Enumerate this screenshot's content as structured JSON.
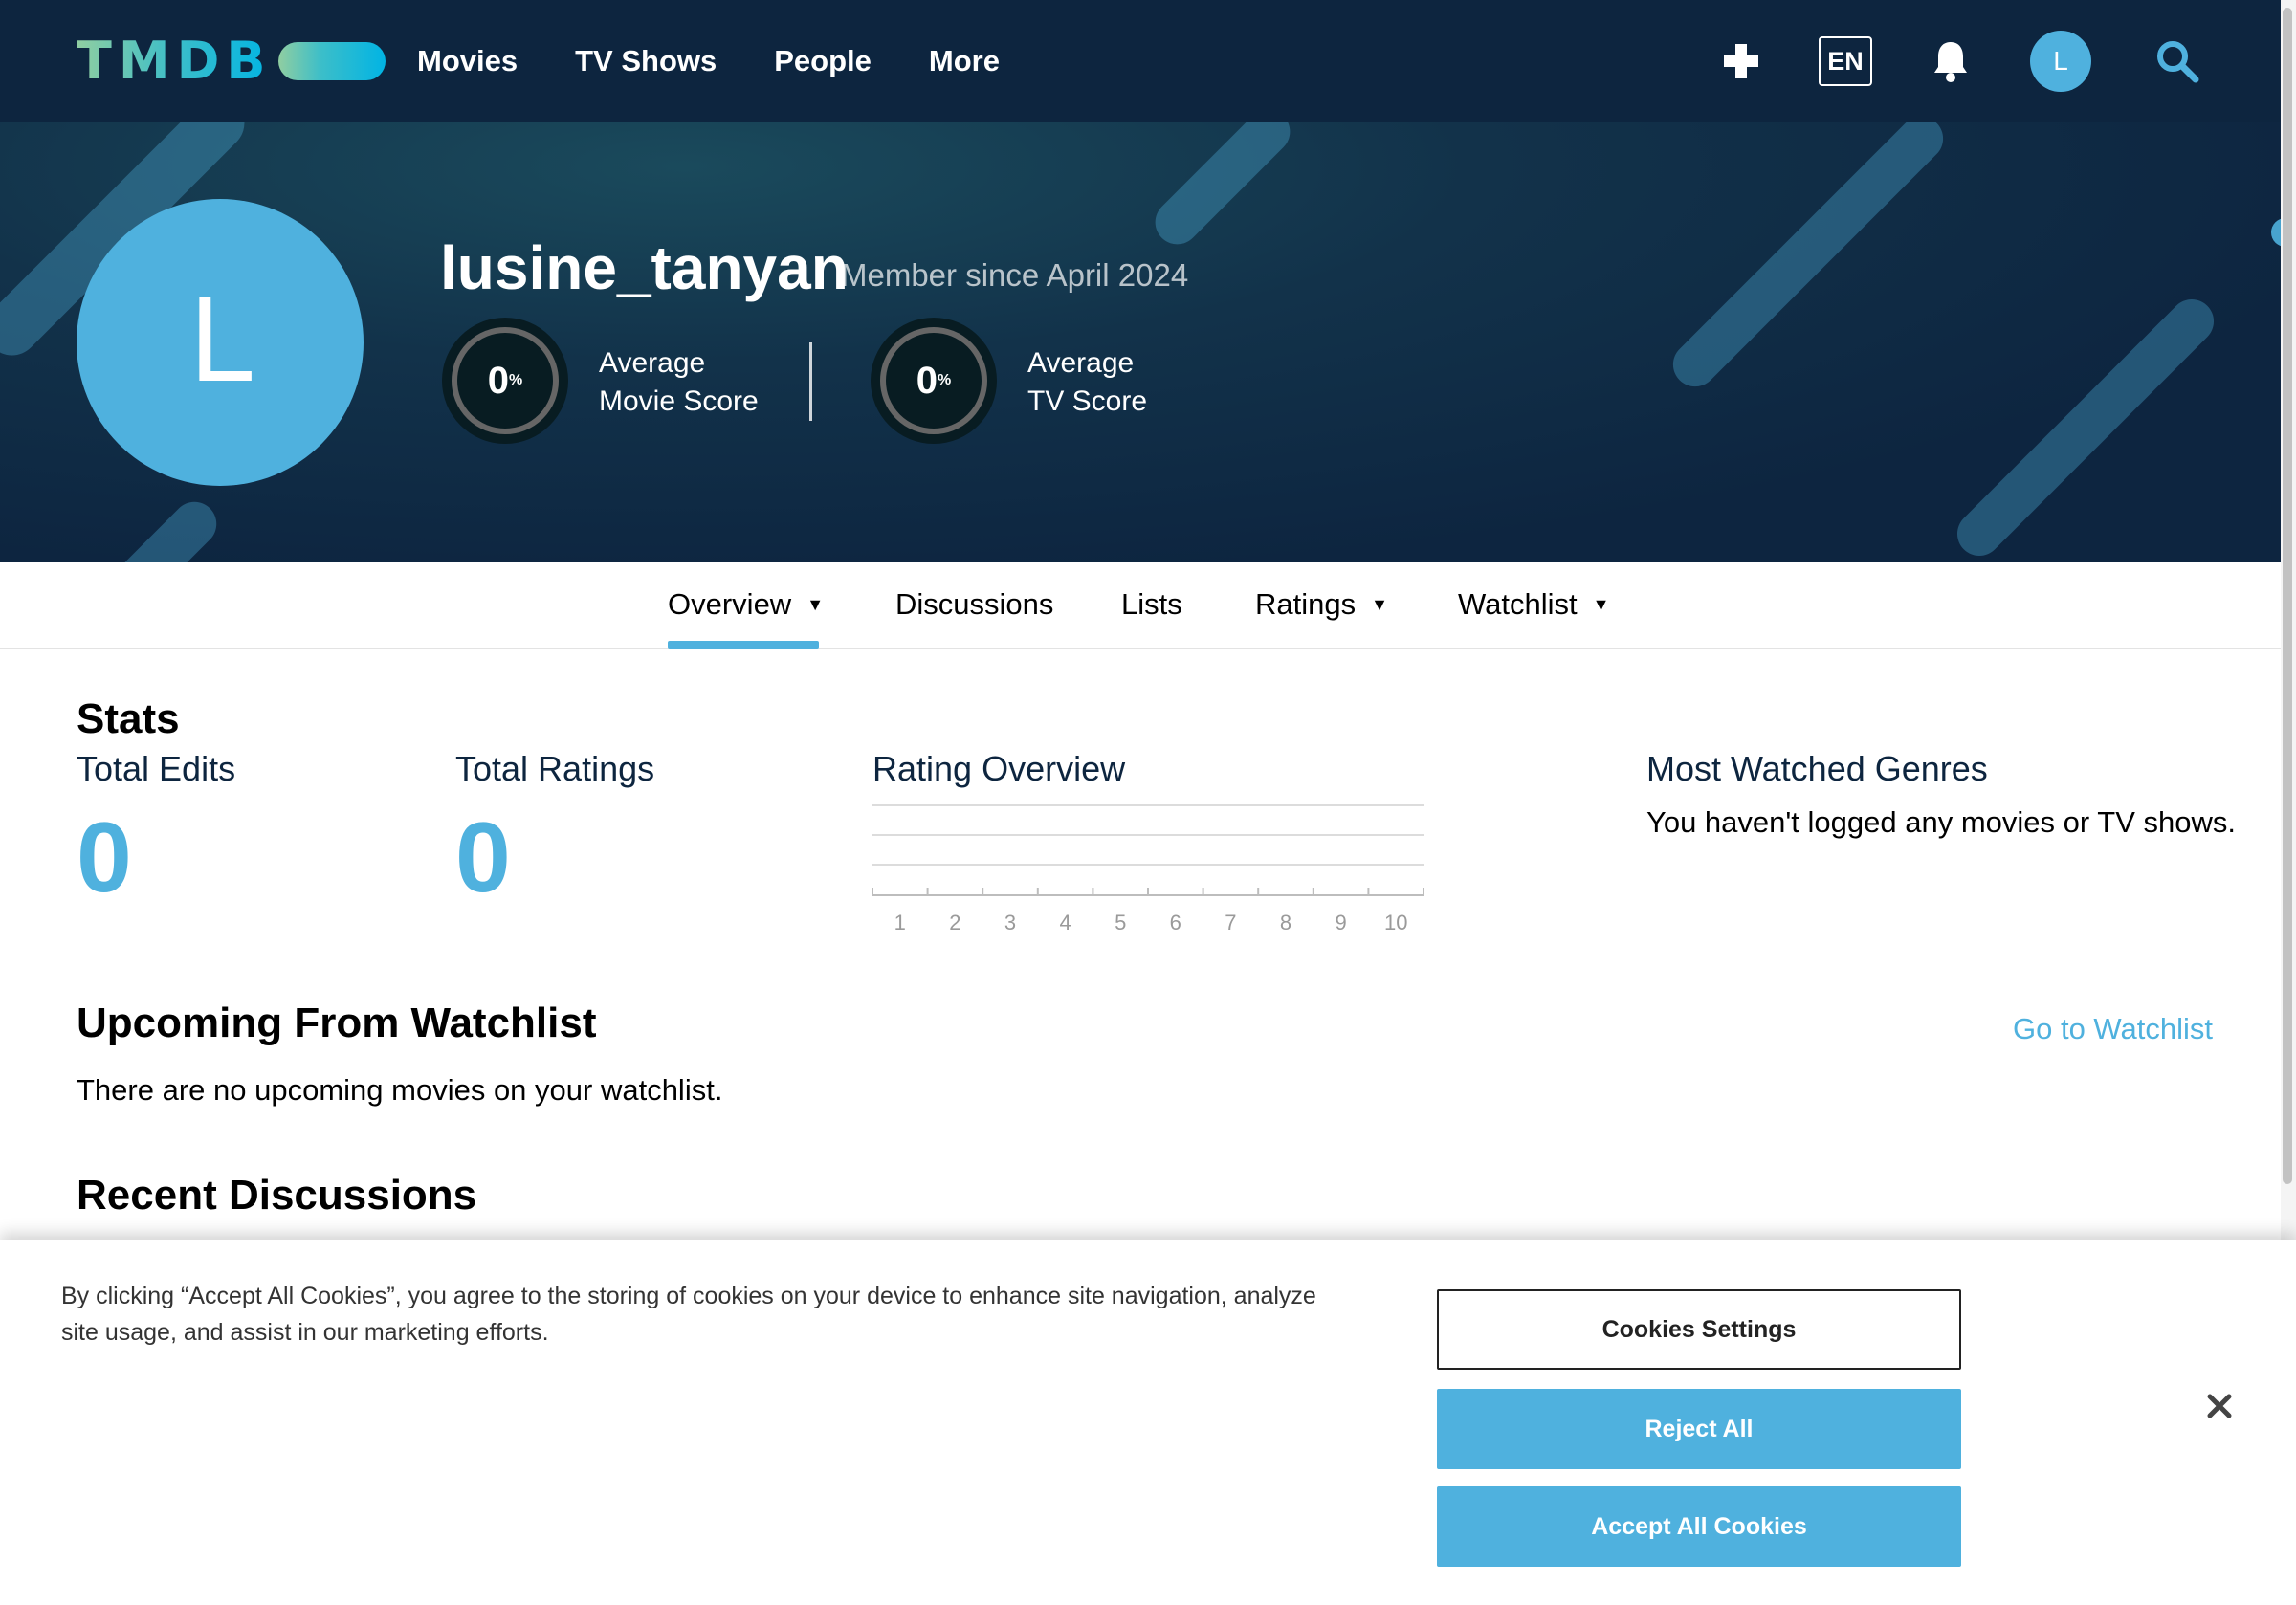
{
  "nav": {
    "logo_text": "TMDB",
    "links": [
      "Movies",
      "TV Shows",
      "People",
      "More"
    ],
    "language": "EN",
    "avatar_initial": "L",
    "icons": [
      "plus-icon",
      "bell-icon",
      "search-icon"
    ]
  },
  "profile": {
    "avatar_initial": "L",
    "username": "lusine_tanyan",
    "member_since": "Member since April 2024",
    "movie_score": {
      "value": "0",
      "unit": "%",
      "label_line1": "Average",
      "label_line2": "Movie Score"
    },
    "tv_score": {
      "value": "0",
      "unit": "%",
      "label_line1": "Average",
      "label_line2": "TV Score"
    }
  },
  "tabs": [
    {
      "label": "Overview",
      "dropdown": true,
      "active": true
    },
    {
      "label": "Discussions",
      "dropdown": false
    },
    {
      "label": "Lists",
      "dropdown": false
    },
    {
      "label": "Ratings",
      "dropdown": true
    },
    {
      "label": "Watchlist",
      "dropdown": true
    }
  ],
  "stats": {
    "heading": "Stats",
    "total_edits_label": "Total Edits",
    "total_edits_value": "0",
    "total_ratings_label": "Total Ratings",
    "total_ratings_value": "0",
    "rating_overview_label": "Rating Overview",
    "most_watched_label": "Most Watched Genres",
    "most_watched_empty": "You haven't logged any movies or TV shows."
  },
  "chart_data": {
    "type": "bar",
    "categories": [
      "1",
      "2",
      "3",
      "4",
      "5",
      "6",
      "7",
      "8",
      "9",
      "10"
    ],
    "values": [
      0,
      0,
      0,
      0,
      0,
      0,
      0,
      0,
      0,
      0
    ],
    "title": "Rating Overview",
    "grid": true
  },
  "watchlist": {
    "heading": "Upcoming From Watchlist",
    "empty_text": "There are no upcoming movies on your watchlist.",
    "link": "Go to Watchlist"
  },
  "discussions": {
    "heading": "Recent Discussions"
  },
  "cookie_banner": {
    "text": "By clicking “Accept All Cookies”, you agree to the storing of cookies on your device to enhance site navigation, analyze site usage, and assist in our marketing efforts.",
    "settings_button": "Cookies Settings",
    "reject_button": "Reject All",
    "accept_button": "Accept All Cookies"
  },
  "colors": {
    "nav_bg": "#0d253f",
    "accent": "#4fb1de",
    "text_dark": "#0d253f"
  }
}
